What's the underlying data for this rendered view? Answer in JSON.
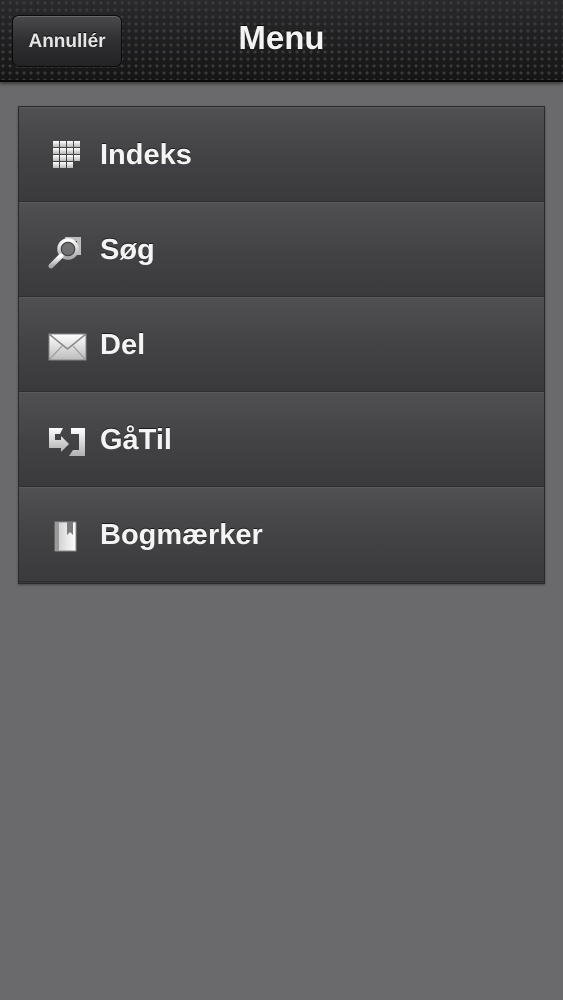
{
  "navbar": {
    "title": "Menu",
    "cancel_label": "Annullér"
  },
  "menu": {
    "items": [
      {
        "label": "Indeks",
        "icon": "grid-icon"
      },
      {
        "label": "Søg",
        "icon": "search-icon"
      },
      {
        "label": "Del",
        "icon": "envelope-icon"
      },
      {
        "label": "GåTil",
        "icon": "goto-arrow-icon"
      },
      {
        "label": "Bogmærker",
        "icon": "bookmark-icon"
      }
    ]
  },
  "colors": {
    "background": "#6a6a6c",
    "navbar": "#1d1d1f",
    "menu_item": "#434346",
    "text": "#f4f4f4"
  }
}
